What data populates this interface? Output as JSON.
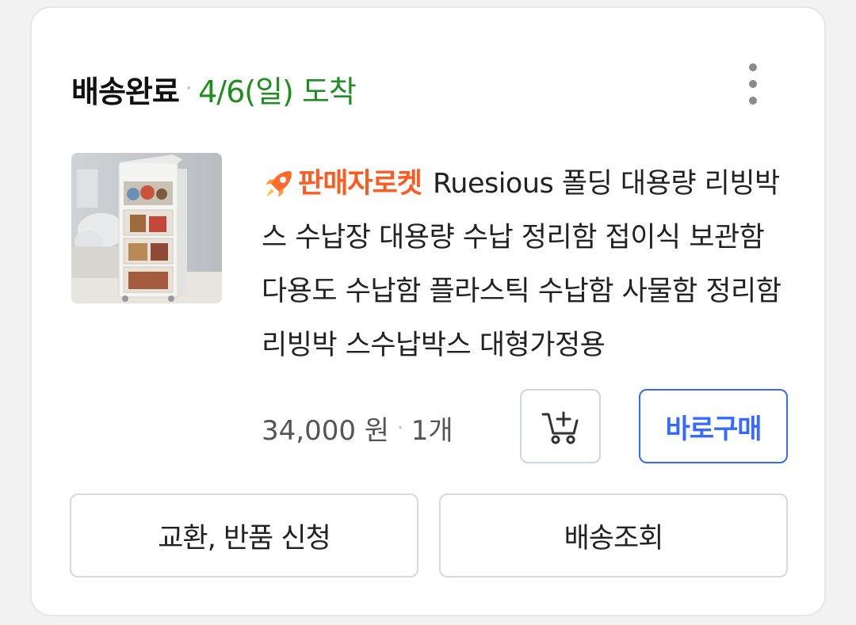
{
  "order": {
    "status": "배송완료",
    "separator": "·",
    "arrival": "4/6(일) 도착"
  },
  "product": {
    "badge_icon": "rocket-icon",
    "badge_label": "판매자로켓",
    "name": "Ruesious 폴딩 대용량 리빙박스 수납장 대용량 수납 정리함 접이식 보관함 다용도 수납함 플라스틱 수납함 사물함 정리함 리빙박 스수납박스 대형가정용",
    "price": "34,000 원",
    "separator": "·",
    "quantity": "1개",
    "thumbnail": "foldable-storage-cabinet-image"
  },
  "actions": {
    "cart_icon": "add-to-cart-icon",
    "buy_now": "바로구매",
    "return_exchange": "교환, 반품 신청",
    "track_delivery": "배송조회",
    "more_icon": "more-vertical-icon"
  },
  "colors": {
    "arrival_green": "#1e8e1e",
    "badge_orange": "#ff5a1f",
    "buy_blue": "#346aff"
  }
}
